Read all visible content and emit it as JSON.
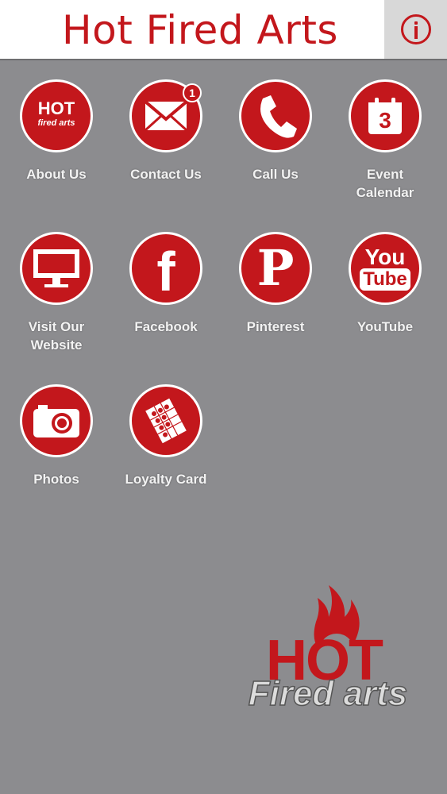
{
  "header": {
    "title": "Hot Fired Arts",
    "info_icon": "info-icon",
    "brand_color": "#c3171c"
  },
  "tiles": [
    {
      "label": "About Us",
      "icon": "hot-fired-arts-logo-icon"
    },
    {
      "label": "Contact Us",
      "icon": "envelope-icon",
      "badge": "1"
    },
    {
      "label": "Call Us",
      "icon": "phone-icon"
    },
    {
      "label": "Event Calendar",
      "icon": "calendar-icon",
      "calendar_day": "3"
    },
    {
      "label": "Visit Our Website",
      "icon": "monitor-icon"
    },
    {
      "label": "Facebook",
      "icon": "facebook-icon",
      "glyph": "f"
    },
    {
      "label": "Pinterest",
      "icon": "pinterest-icon",
      "glyph": "P"
    },
    {
      "label": "YouTube",
      "icon": "youtube-icon",
      "you": "You",
      "tube": "Tube"
    },
    {
      "label": "Photos",
      "icon": "camera-icon"
    },
    {
      "label": "Loyalty Card",
      "icon": "loyalty-card-icon"
    }
  ],
  "about_logo": {
    "top": "HOT",
    "bottom": "fired arts"
  },
  "footer_logo": {
    "top": "HOT",
    "bottom": "Fired arts"
  }
}
